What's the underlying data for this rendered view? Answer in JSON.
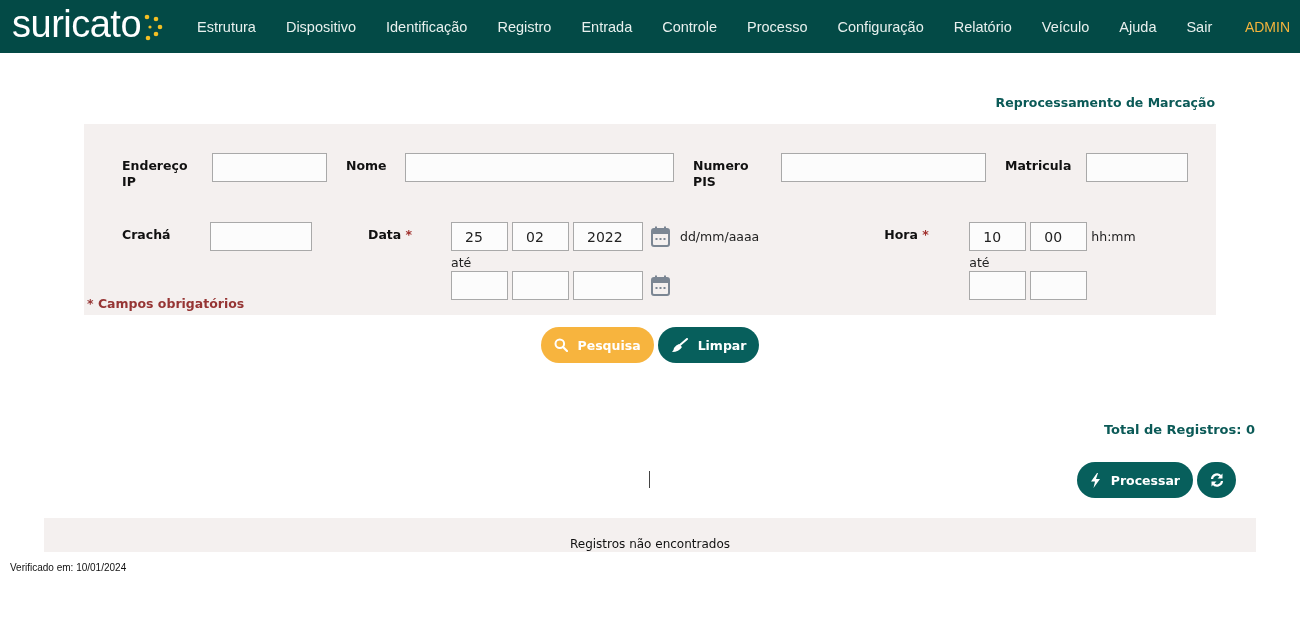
{
  "header": {
    "logo": "suricato",
    "menu": [
      "Estrutura",
      "Dispositivo",
      "Identificação",
      "Registro",
      "Entrada",
      "Controle",
      "Processo",
      "Configuração",
      "Relatório",
      "Veículo",
      "Ajuda",
      "Sair"
    ],
    "user": "ADMIN"
  },
  "page_title": "Reprocessamento de Marcação",
  "filters": {
    "row1": [
      {
        "label": "Endereço IP"
      },
      {
        "label": "Nome"
      },
      {
        "label": "Numero PIS"
      },
      {
        "label": "Matricula"
      }
    ],
    "required_mark": "*",
    "badge": {
      "label": "Crachá"
    },
    "date": {
      "label": "Data",
      "required": true,
      "from": [
        "25",
        "02",
        "2022"
      ],
      "to_label": "até",
      "format": "dd/mm/aaaa"
    },
    "hour": {
      "label": "Hora",
      "required": true,
      "from": [
        "10",
        "00"
      ],
      "to_label": "até",
      "format": "hh:mm"
    },
    "required_note": "* Campos obrigatórios"
  },
  "buttons": [
    {
      "label": "Pesquisa",
      "kind": "search"
    },
    {
      "label": "Limpar",
      "kind": "clear"
    }
  ],
  "total": "Total de Registros: 0",
  "actions": [
    {
      "label": "Processar",
      "kind": "process"
    },
    {
      "kind": "refresh"
    }
  ],
  "table": {
    "empty_message": "Registros não encontrados"
  },
  "footer": "Verificado em: 10/01/2024"
}
